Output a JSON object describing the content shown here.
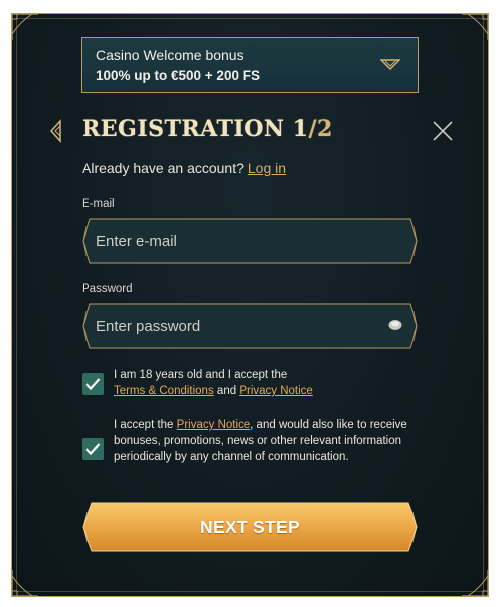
{
  "bonus": {
    "title": "Casino Welcome bonus",
    "offer": "100% up to €500 + 200 FS"
  },
  "heading": {
    "title": "REGISTRATION 1",
    "step_suffix": "/2"
  },
  "login_prompt": {
    "text": "Already have an account?",
    "link": "Log in"
  },
  "email": {
    "label": "E-mail",
    "placeholder": "Enter e-mail",
    "value": ""
  },
  "password": {
    "label": "Password",
    "placeholder": "Enter password",
    "value": ""
  },
  "consent_age": {
    "checked": true,
    "text_before": "I am 18 years old and I accept the",
    "terms_link": "Terms & Conditions",
    "joiner": "and",
    "privacy_link": "Privacy Notice"
  },
  "consent_marketing": {
    "checked": true,
    "text_before": "I accept the",
    "privacy_link": "Privacy Notice",
    "text_after": ", and would also like to receive bonuses, promotions, news or other relevant information periodically by any channel of communication."
  },
  "next_button": {
    "label": "NEXT STEP"
  },
  "icons": {
    "back": "chevron-left-icon",
    "close": "close-icon",
    "dropdown": "chevron-down-icon",
    "eye": "eye-icon",
    "check": "checkmark-icon"
  },
  "colors": {
    "background": "#101b20",
    "gold": "#b89a62",
    "link": "#e3a95a",
    "checkbox": "#2f6b5f",
    "button_top": "#f5c266",
    "button_bottom": "#d3892a"
  }
}
